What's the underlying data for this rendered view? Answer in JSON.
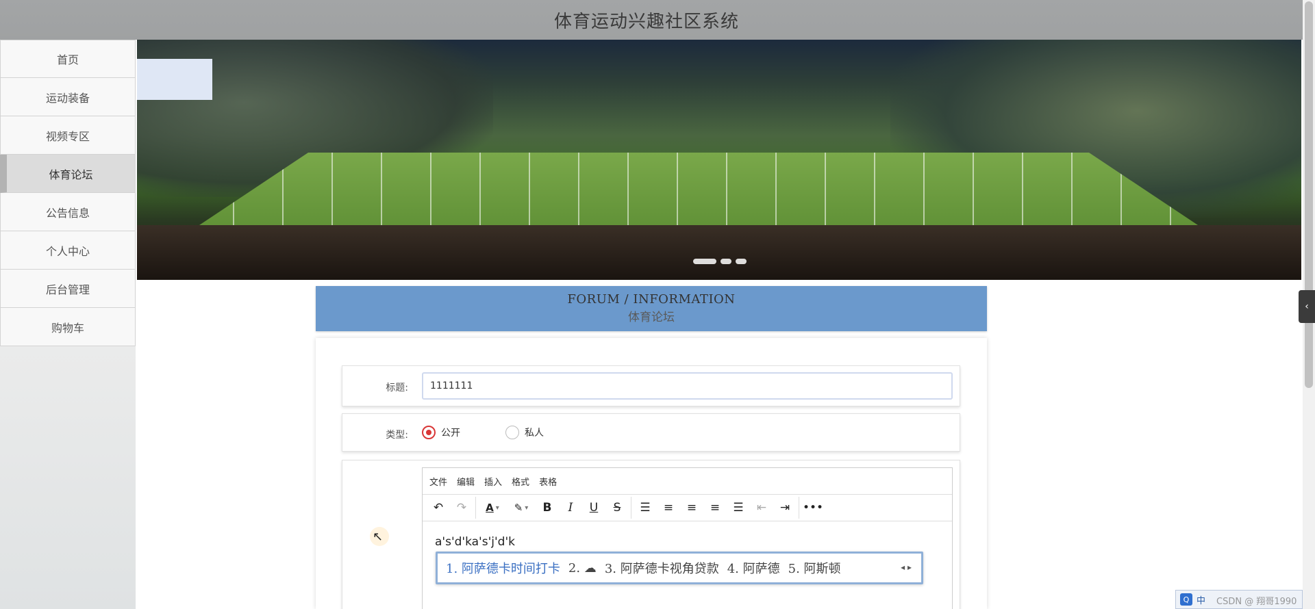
{
  "header": {
    "title": "体育运动兴趣社区系统"
  },
  "sidebar": {
    "items": [
      {
        "label": "首页"
      },
      {
        "label": "运动装备"
      },
      {
        "label": "视频专区"
      },
      {
        "label": "体育论坛",
        "active": true
      },
      {
        "label": "公告信息"
      },
      {
        "label": "个人中心"
      },
      {
        "label": "后台管理"
      },
      {
        "label": "购物车"
      }
    ]
  },
  "banner": {
    "slides_count": 3,
    "active_slide": 0
  },
  "section": {
    "title_en": "FORUM / INFORMATION",
    "title_cn": "体育论坛"
  },
  "form": {
    "title_label": "标题:",
    "title_value": "1111111",
    "type_label": "类型:",
    "type_options": [
      {
        "label": "公开",
        "checked": true
      },
      {
        "label": "私人",
        "checked": false
      }
    ],
    "editor": {
      "menu": [
        "文件",
        "编辑",
        "插入",
        "格式",
        "表格"
      ],
      "toolbar_icons": [
        "undo-icon",
        "redo-icon",
        "font-color-icon",
        "highlight-icon",
        "bold-icon",
        "italic-icon",
        "underline-icon",
        "strikethrough-icon",
        "bullet-list-icon",
        "align-left-icon",
        "align-center-icon",
        "align-right-icon",
        "align-justify-icon",
        "outdent-icon",
        "indent-icon",
        "more-icon"
      ],
      "content": "a's'd'ka's'j'd'k"
    }
  },
  "ime": {
    "candidates": [
      "1. 阿萨德卡时间打卡",
      "2. ☁",
      "3. 阿萨德卡视角贷款",
      "4. 阿萨德",
      "5. 阿斯顿"
    ]
  },
  "tray": {
    "lang": "中"
  },
  "watermark": "CSDN @ 翔哥1990"
}
